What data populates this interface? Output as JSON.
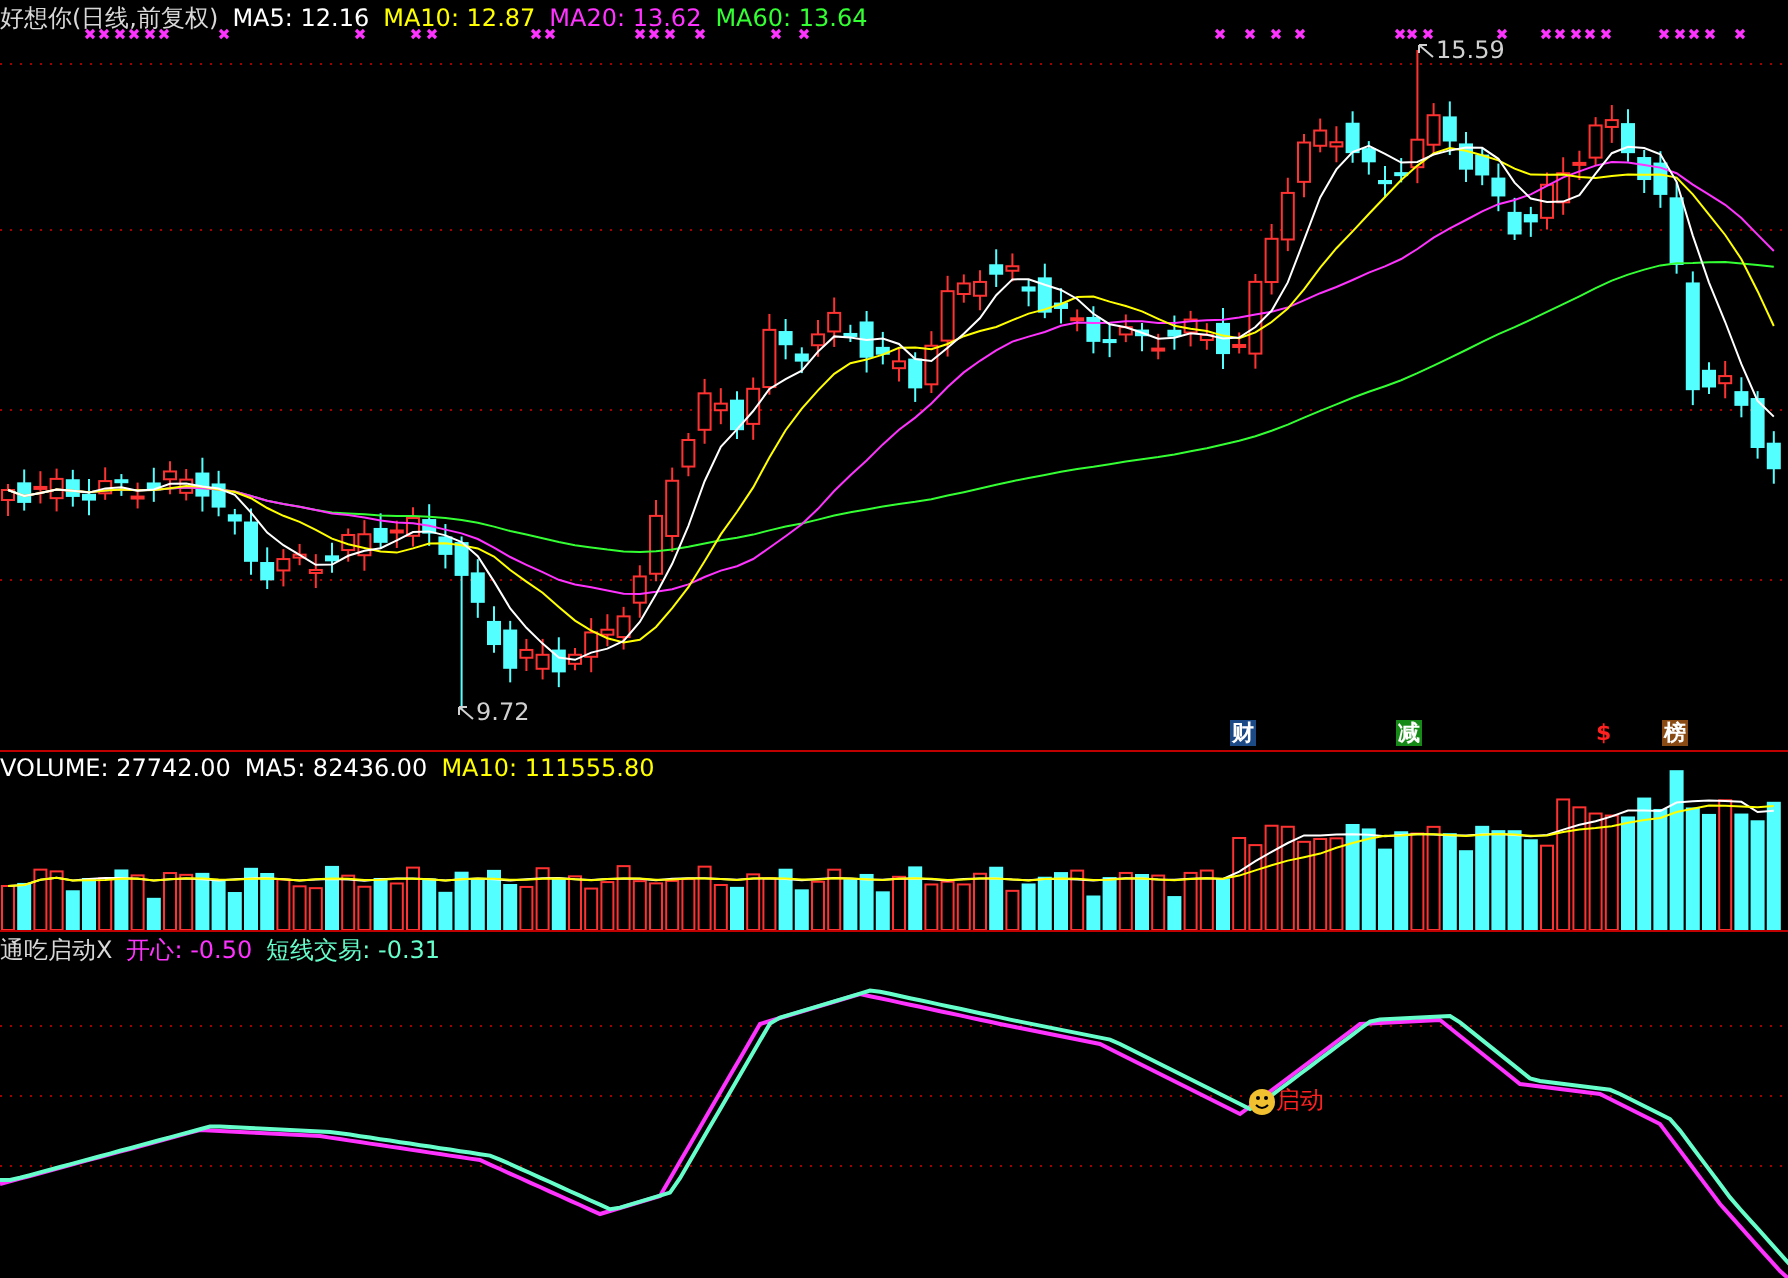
{
  "main": {
    "title": "好想你(日线,前复权)",
    "legend": [
      {
        "label": "MA5: 12.16",
        "color": "#ffffff"
      },
      {
        "label": "MA10: 12.87",
        "color": "#ffff00"
      },
      {
        "label": "MA20: 13.62",
        "color": "#ff33ff"
      },
      {
        "label": "MA60: 13.64",
        "color": "#33ff33"
      }
    ],
    "price_labels": [
      {
        "kind": "high",
        "text": "15.59"
      },
      {
        "kind": "low",
        "text": "9.72"
      }
    ],
    "event_badges": [
      {
        "kind": "tag",
        "text": "财",
        "color": "#1c4a86"
      },
      {
        "kind": "tag",
        "text": "减",
        "color": "#168a16"
      },
      {
        "kind": "symbol",
        "text": "$",
        "color": "#ff2020"
      },
      {
        "kind": "tag",
        "text": "榜",
        "color": "#8a4a14"
      }
    ]
  },
  "volume": {
    "legend": [
      {
        "label": "VOLUME: 27742.00",
        "color": "#ffffff"
      },
      {
        "label": "MA5: 82436.00",
        "color": "#ffffff"
      },
      {
        "label": "MA10: 111555.80",
        "color": "#ffff00"
      }
    ]
  },
  "indicator": {
    "title": "通吃启动X",
    "legend": [
      {
        "label": "开心: -0.50",
        "color": "#ff33ff"
      },
      {
        "label": "短线交易: -0.31",
        "color": "#66ffcc"
      }
    ],
    "signal": {
      "text": "启动"
    }
  }
}
